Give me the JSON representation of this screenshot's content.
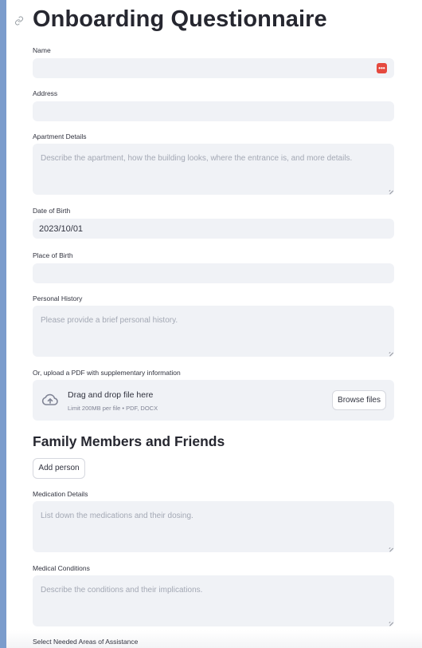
{
  "title": "Onboarding Questionnaire",
  "icons": {
    "anchor": "link-icon",
    "password_manager": "password-manager-icon",
    "upload": "cloud-upload-icon"
  },
  "fields": {
    "name": {
      "label": "Name",
      "value": ""
    },
    "address": {
      "label": "Address",
      "value": ""
    },
    "apartment": {
      "label": "Apartment Details",
      "placeholder": "Describe the apartment, how the building looks, where the entrance is, and more details."
    },
    "dob": {
      "label": "Date of Birth",
      "value": "2023/10/01"
    },
    "pob": {
      "label": "Place of Birth",
      "value": ""
    },
    "history": {
      "label": "Personal History",
      "placeholder": "Please provide a brief personal history."
    },
    "upload": {
      "label": "Or, upload a PDF with supplementary information",
      "drop_text": "Drag and drop file here",
      "limit_text": "Limit 200MB per file • PDF, DOCX",
      "browse_label": "Browse files"
    }
  },
  "family": {
    "heading": "Family Members and Friends",
    "add_label": "Add person"
  },
  "medication": {
    "label": "Medication Details",
    "placeholder": "List down the medications and their dosing."
  },
  "conditions": {
    "label": "Medical Conditions",
    "placeholder": "Describe the conditions and their implications."
  },
  "assistance": {
    "label": "Select Needed Areas of Assistance"
  },
  "colors": {
    "background": "#7b9ccc",
    "input_bg": "#f0f2f6",
    "badge": "#e5493e"
  }
}
